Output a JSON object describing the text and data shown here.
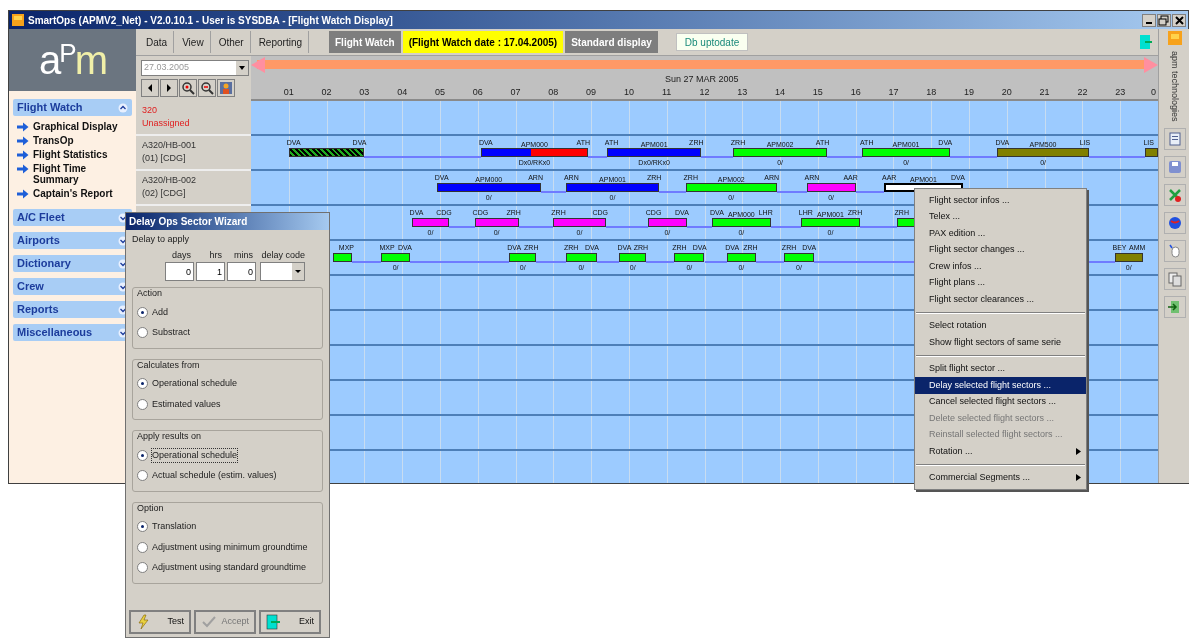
{
  "window": {
    "title": "SmartOps (APMV2_Net) - V2.0.10.1 - User is SYSDBA - [Flight Watch Display]"
  },
  "sidebar": {
    "logo": "aPm",
    "sections": [
      {
        "label": "Flight Watch",
        "expanded": true,
        "items": [
          "Graphical Display",
          "TransOp",
          "Flight Statistics",
          "Flight Time Summary",
          "Captain's Report"
        ]
      },
      {
        "label": "A/C Fleet",
        "expanded": false
      },
      {
        "label": "Airports",
        "expanded": false
      },
      {
        "label": "Dictionary",
        "expanded": false
      },
      {
        "label": "Crew",
        "expanded": false
      },
      {
        "label": "Reports",
        "expanded": false
      },
      {
        "label": "Miscellaneous",
        "expanded": false
      }
    ]
  },
  "menu": [
    "Data",
    "View",
    "Other",
    "Reporting"
  ],
  "toolbar": [
    {
      "label": "Flight Watch",
      "kind": "mode"
    },
    {
      "label": "(Flight Watch date : 17.04.2005)",
      "kind": "highlight"
    },
    {
      "label": "Standard display",
      "kind": "mode"
    }
  ],
  "status_field": "Db uptodate",
  "date_field": "27.03.2005",
  "timeline": {
    "date": "Sun 27 MAR 2005",
    "hours": [
      "01",
      "02",
      "03",
      "04",
      "05",
      "06",
      "07",
      "08",
      "09",
      "10",
      "11",
      "12",
      "13",
      "14",
      "15",
      "16",
      "17",
      "18",
      "19",
      "20",
      "21",
      "22",
      "23",
      "0"
    ]
  },
  "rows": [
    {
      "kind": "unassigned",
      "line1": "320",
      "line2": "Unassigned",
      "sectors": []
    },
    {
      "kind": "aircraft",
      "line1": "A320/HB-001",
      "line2": "(01) [CDG]",
      "sectors": [
        {
          "kind": "hatched",
          "from": "DVA",
          "to": "DVA",
          "selected": false
        },
        {
          "kind": "delayed",
          "from": "DVA",
          "to": "ATH",
          "code": "APM000",
          "sub": "Dx0/RKx0",
          "color": "#0000ff",
          "selected": false
        },
        {
          "kind": "bar",
          "from": "ATH",
          "to": "ZRH",
          "code": "APM001",
          "sub": "Dx0/RKx0",
          "color": "#0000ff",
          "selected": false
        },
        {
          "kind": "bar",
          "from": "ZRH",
          "to": "ATH",
          "code": "APM002",
          "sub": "0/",
          "color": "#00ff00",
          "selected": false
        },
        {
          "kind": "bar",
          "from": "ATH",
          "to": "DVA",
          "code": "APM001",
          "sub": "0/",
          "color": "#00ff00",
          "selected": false
        },
        {
          "kind": "bar",
          "from": "DVA",
          "to": "LIS",
          "code": "APM500",
          "sub": "0/",
          "color": "#808000",
          "selected": false
        },
        {
          "kind": "bar",
          "from": "LIS",
          "color": "#808000",
          "selected": false
        }
      ]
    },
    {
      "kind": "aircraft",
      "line1": "A320/HB-002",
      "line2": "(02) [CDG]",
      "sectors": [
        {
          "kind": "bar",
          "from": "DVA",
          "to": "ARN",
          "code": "APM000",
          "sub": "0/",
          "color": "#0000ff",
          "selected": false
        },
        {
          "kind": "bar",
          "from": "ARN",
          "to": "ZRH",
          "code": "APM001",
          "sub": "0/",
          "color": "#0000ff",
          "selected": false
        },
        {
          "kind": "bar",
          "from": "ZRH",
          "to": "ARN",
          "code": "APM002",
          "sub": "0/",
          "color": "#00ff00",
          "selected": false
        },
        {
          "kind": "bar",
          "from": "ARN",
          "to": "AAR",
          "sub": "0/",
          "color": "#ff00ff",
          "selected": false
        },
        {
          "kind": "bar",
          "from": "AAR",
          "to": "DVA",
          "code": "APM001",
          "color": "#ffffff",
          "selected": true
        }
      ]
    },
    {
      "kind": "hidden",
      "sectors": [
        {
          "kind": "bar",
          "from": "DVA",
          "to": "CDG",
          "sub": "0/",
          "color": "#ff00ff",
          "selected": false
        },
        {
          "kind": "bar",
          "from": "CDG",
          "to": "ZRH",
          "sub": "0/",
          "color": "#ff00ff",
          "selected": false
        },
        {
          "kind": "bar",
          "from": "ZRH",
          "to": "CDG",
          "sub": "0/",
          "color": "#ff00ff",
          "selected": false
        },
        {
          "kind": "bar",
          "from": "CDG",
          "to": "DVA",
          "sub": "0/",
          "color": "#ff00ff",
          "selected": false
        },
        {
          "kind": "bar",
          "from": "DVA",
          "to": "LHR",
          "code": "APM000",
          "sub": "0/",
          "color": "#00ff00",
          "selected": false
        },
        {
          "kind": "bar",
          "from": "LHR",
          "to": "ZRH",
          "code": "APM001",
          "sub": "0/",
          "color": "#00ff00",
          "selected": false
        },
        {
          "kind": "bar",
          "from": "ZRH",
          "color": "#00ff00",
          "selected": false
        }
      ]
    },
    {
      "kind": "hidden",
      "sectors": [
        {
          "kind": "bar",
          "to": "MXP",
          "color": "#00ff00",
          "selected": false
        },
        {
          "kind": "bar",
          "from": "MXP",
          "to": "DVA",
          "sub": "0/",
          "color": "#00ff00",
          "selected": false
        },
        {
          "kind": "bar",
          "from": "DVA",
          "to": "ZRH",
          "sub": "0/",
          "color": "#00ff00",
          "selected": false
        },
        {
          "kind": "bar",
          "from": "ZRH",
          "to": "DVA",
          "sub": "0/",
          "color": "#00ff00",
          "selected": false
        },
        {
          "kind": "bar",
          "from": "DVA",
          "to": "ZRH",
          "sub": "0/",
          "color": "#00ff00",
          "selected": false
        },
        {
          "kind": "bar",
          "from": "ZRH",
          "to": "DVA",
          "sub": "0/",
          "color": "#00ff00",
          "selected": false
        },
        {
          "kind": "bar",
          "from": "DVA",
          "to": "ZRH",
          "sub": "0/",
          "color": "#00ff00",
          "selected": false
        },
        {
          "kind": "bar",
          "from": "ZRH",
          "to": "DVA",
          "sub": "0/",
          "color": "#00ff00",
          "selected": false
        },
        {
          "kind": "bar",
          "from": "BEY",
          "to": "AMM",
          "sub": "0/",
          "color": "#808000",
          "selected": false
        }
      ]
    }
  ],
  "dialog": {
    "title": "Delay Ops Sector Wizard",
    "heading": "Delay to apply",
    "fields": [
      {
        "label": "days",
        "value": "0"
      },
      {
        "label": "hrs",
        "value": "1"
      },
      {
        "label": "mins",
        "value": "0"
      }
    ],
    "code_label": "delay code",
    "groups": [
      {
        "title": "Action",
        "options": [
          {
            "label": "Add",
            "selected": true
          },
          {
            "label": "Substract",
            "selected": false
          }
        ]
      },
      {
        "title": "Calculates from",
        "options": [
          {
            "label": "Operational schedule",
            "selected": true
          },
          {
            "label": "Estimated values",
            "selected": false
          }
        ]
      },
      {
        "title": "Apply results on",
        "options": [
          {
            "label": "Operational schedule",
            "selected": true
          },
          {
            "label": "Actual schedule (estim. values)",
            "selected": false
          }
        ]
      },
      {
        "title": "Option",
        "options": [
          {
            "label": "Translation",
            "selected": true
          },
          {
            "label": "Adjustment using minimum groundtime",
            "selected": false
          },
          {
            "label": "Adjustment using standard groundtime",
            "selected": false
          }
        ]
      }
    ],
    "buttons": [
      {
        "kind": "test",
        "label": "Test",
        "disabled": false
      },
      {
        "kind": "accept",
        "label": "Accept",
        "disabled": true
      },
      {
        "kind": "exit",
        "label": "Exit",
        "disabled": false
      }
    ]
  },
  "context_menu": [
    [
      {
        "label": "Flight sector infos ...",
        "selected": false,
        "disabled": false,
        "submenu": false
      },
      {
        "label": "Telex ...",
        "selected": false,
        "disabled": false,
        "submenu": false
      },
      {
        "label": "PAX edition ...",
        "selected": false,
        "disabled": false,
        "submenu": false
      },
      {
        "label": "Flight sector changes ...",
        "selected": false,
        "disabled": false,
        "submenu": false
      },
      {
        "label": "Crew infos ...",
        "selected": false,
        "disabled": false,
        "submenu": false
      },
      {
        "label": "Flight plans ...",
        "selected": false,
        "disabled": false,
        "submenu": false
      },
      {
        "label": "Flight sector clearances ...",
        "selected": false,
        "disabled": false,
        "submenu": false
      }
    ],
    [
      {
        "label": "Select rotation",
        "selected": false,
        "disabled": false,
        "submenu": false
      },
      {
        "label": "Show flight sectors of same serie",
        "selected": false,
        "disabled": false,
        "submenu": false
      }
    ],
    [
      {
        "label": "Split flight sector ...",
        "selected": false,
        "disabled": false,
        "submenu": false
      },
      {
        "label": "Delay selected flight sectors ...",
        "selected": true,
        "disabled": false,
        "submenu": false
      },
      {
        "label": "Cancel selected flight sectors ...",
        "selected": false,
        "disabled": false,
        "submenu": false
      },
      {
        "label": "Delete selected flight sectors ...",
        "selected": false,
        "disabled": true,
        "submenu": false
      },
      {
        "label": "Reinstall selected flight sectors ...",
        "selected": false,
        "disabled": true,
        "submenu": false
      },
      {
        "label": "Rotation ...",
        "selected": false,
        "disabled": false,
        "submenu": true
      }
    ],
    [
      {
        "label": "Commercial Segments ...",
        "selected": false,
        "disabled": false,
        "submenu": true
      }
    ]
  ],
  "side_toolbar": {
    "brand": "apm technologies"
  }
}
